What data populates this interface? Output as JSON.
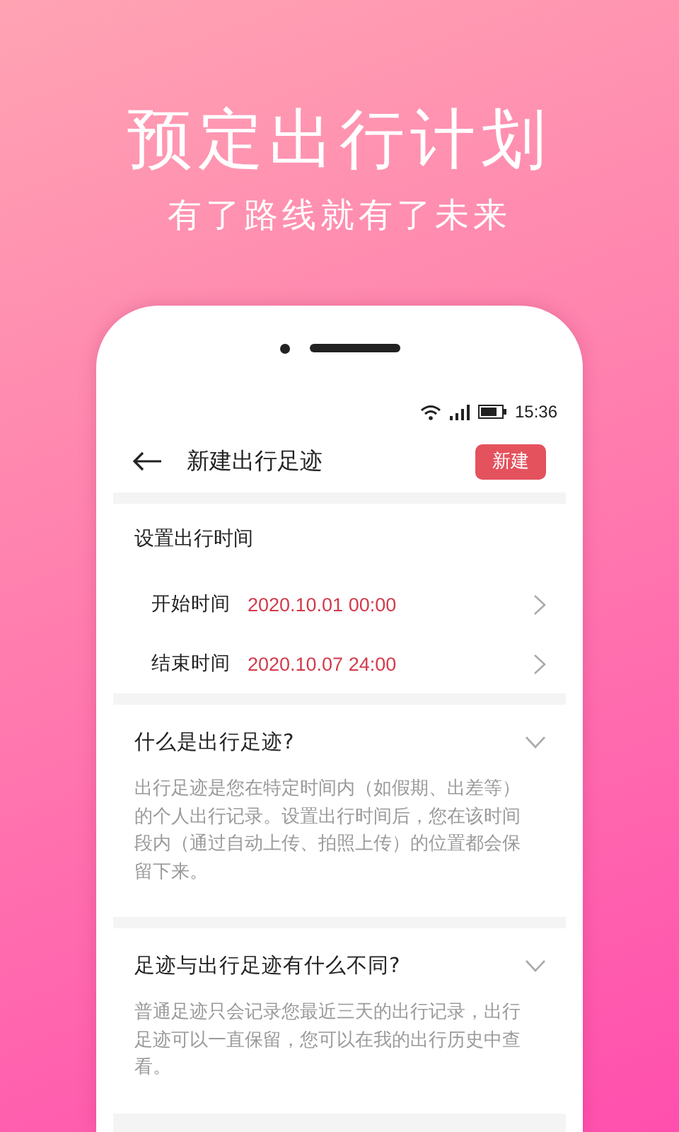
{
  "banner": {
    "title": "预定出行计划",
    "subtitle": "有了路线就有了未来"
  },
  "status_bar": {
    "time": "15:36"
  },
  "app_bar": {
    "title": "新建出行足迹",
    "action": "新建"
  },
  "time_section": {
    "heading": "设置出行时间",
    "rows": [
      {
        "label": "开始时间",
        "value": "2020.10.01 00:00"
      },
      {
        "label": "结束时间",
        "value": "2020.10.07 24:00"
      }
    ]
  },
  "faq": [
    {
      "question": "什么是出行足迹?",
      "expanded": true,
      "answer": "出行足迹是您在特定时间内（如假期、出差等）的个人出行记录。设置出行时间后，您在该时间段内（通过自动上传、拍照上传）的位置都会保留下来。"
    },
    {
      "question": "足迹与出行足迹有什么不同?",
      "expanded": true,
      "answer": "普通足迹只会记录您最近三天的出行记录，出行足迹可以一直保留，您可以在我的出行历史中查看。"
    }
  ]
}
